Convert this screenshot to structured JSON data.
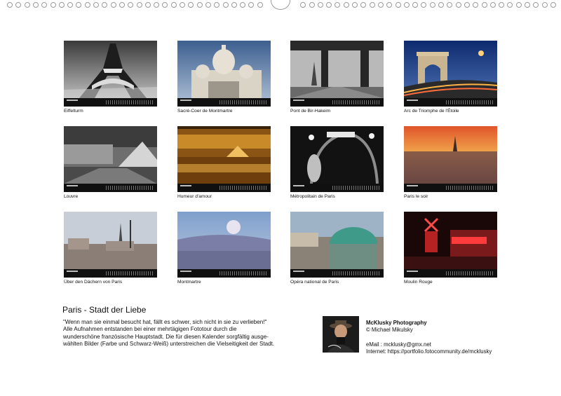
{
  "calendar": {
    "title": "Paris - Stadt der Liebe",
    "description_lines": [
      "\"Wenn man sie einmal besucht hat, fällt es schwer, sich nicht in sie zu verlieben!\"",
      "Alle Aufnahmen entstanden bei einer mehrtägigen Fototour durch die",
      "wunderschöne französische Hauptstadt. Die für diesen Kalender sorgfältig ausge-",
      "wählten Bilder (Farbe und Schwarz-Weiß) unterstreichen die Vielseitigkeit der Stadt."
    ]
  },
  "months": [
    {
      "caption": "Eiffelturm"
    },
    {
      "caption": "Sacré-Coer de Montmartre"
    },
    {
      "caption": "Pont de Bir-Hakeim"
    },
    {
      "caption": "Arc de Triomphe de l'Étoile"
    },
    {
      "caption": "Louvre"
    },
    {
      "caption": "Humeur d'amour"
    },
    {
      "caption": "Métropolitain de Paris"
    },
    {
      "caption": "Paris le soir"
    },
    {
      "caption": "Über den Dächern von Paris"
    },
    {
      "caption": "Montmartre"
    },
    {
      "caption": "Opéra national de Paris"
    },
    {
      "caption": "Moulin Rouge"
    }
  ],
  "author": {
    "name": "McKlusky Photography",
    "copyright": "© Michael Mikulsky",
    "email_line": "eMail   :  mcklusky@gmx.net",
    "internet_line": "Internet: https://portfolio.fotocommunity.de/mcklusky"
  },
  "colors": {
    "page_background": "#ffffff",
    "calendar_strip": "#101010",
    "binding_ring": "#9a9a9a"
  }
}
